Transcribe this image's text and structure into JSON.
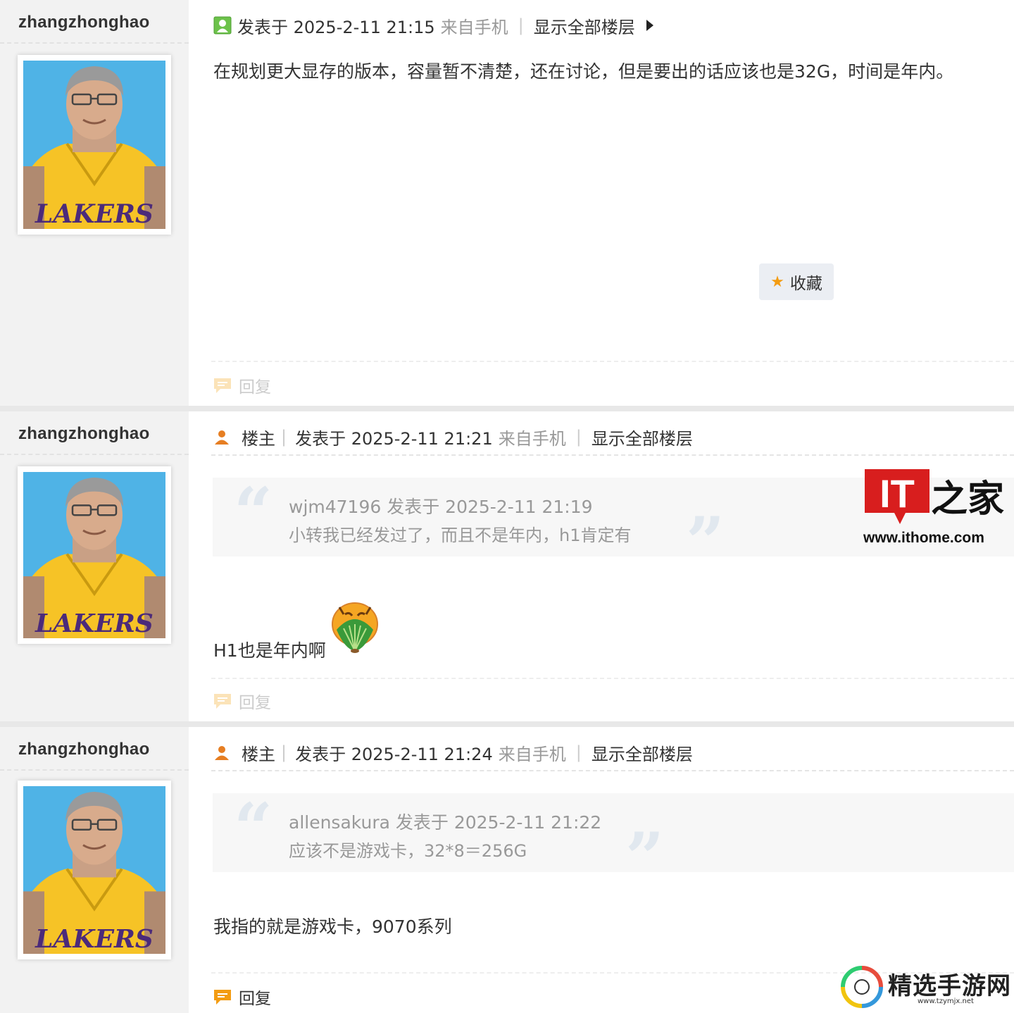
{
  "posts": [
    {
      "username": "zhangzhonghao",
      "is_op": false,
      "op_label": "",
      "posted_prefix": "发表于 2025-2-11 21:15",
      "source": "来自手机",
      "show_all": "显示全部楼层",
      "body": "在规划更大显存的版本，容量暂不清楚，还在讨论，但是要出的话应该也是32G，时间是年内。",
      "favorite_label": "收藏",
      "reply_label": "回复"
    },
    {
      "username": "zhangzhonghao",
      "is_op": true,
      "op_label": "楼主",
      "posted_prefix": "发表于 2025-2-11 21:21",
      "source": "来自手机",
      "show_all": "显示全部楼层",
      "quote_line1": "wjm47196 发表于 2025-2-11 21:19",
      "quote_line2": "小转我已经发过了，而且不是年内，h1肯定有",
      "body": "H1也是年内啊",
      "reply_label": "回复"
    },
    {
      "username": "zhangzhonghao",
      "is_op": true,
      "op_label": "楼主",
      "posted_prefix": "发表于 2025-2-11 21:24",
      "source": "来自手机",
      "show_all": "显示全部楼层",
      "quote_line1": "allensakura 发表于 2025-2-11 21:22",
      "quote_line2": "应该不是游戏卡，32*8＝256G",
      "body": "我指的就是游戏卡，9070系列",
      "reply_label": "回复"
    }
  ],
  "avatar_jersey_text": "LAKERS",
  "watermark": {
    "logo_text": "IT之家",
    "url": "www.ithome.com"
  },
  "watermark2": {
    "title": "精选手游网",
    "url": "www.tzymjx.net"
  },
  "colors": {
    "sidebar_bg": "#f2f2f2",
    "accent_orange": "#f39c12",
    "op_icon": "#e67e22",
    "muted_text": "#999999"
  },
  "icons": [
    "user-icon",
    "op-user-icon",
    "arrow-right-icon",
    "star-icon",
    "reply-icon",
    "emoticon-icon"
  ]
}
